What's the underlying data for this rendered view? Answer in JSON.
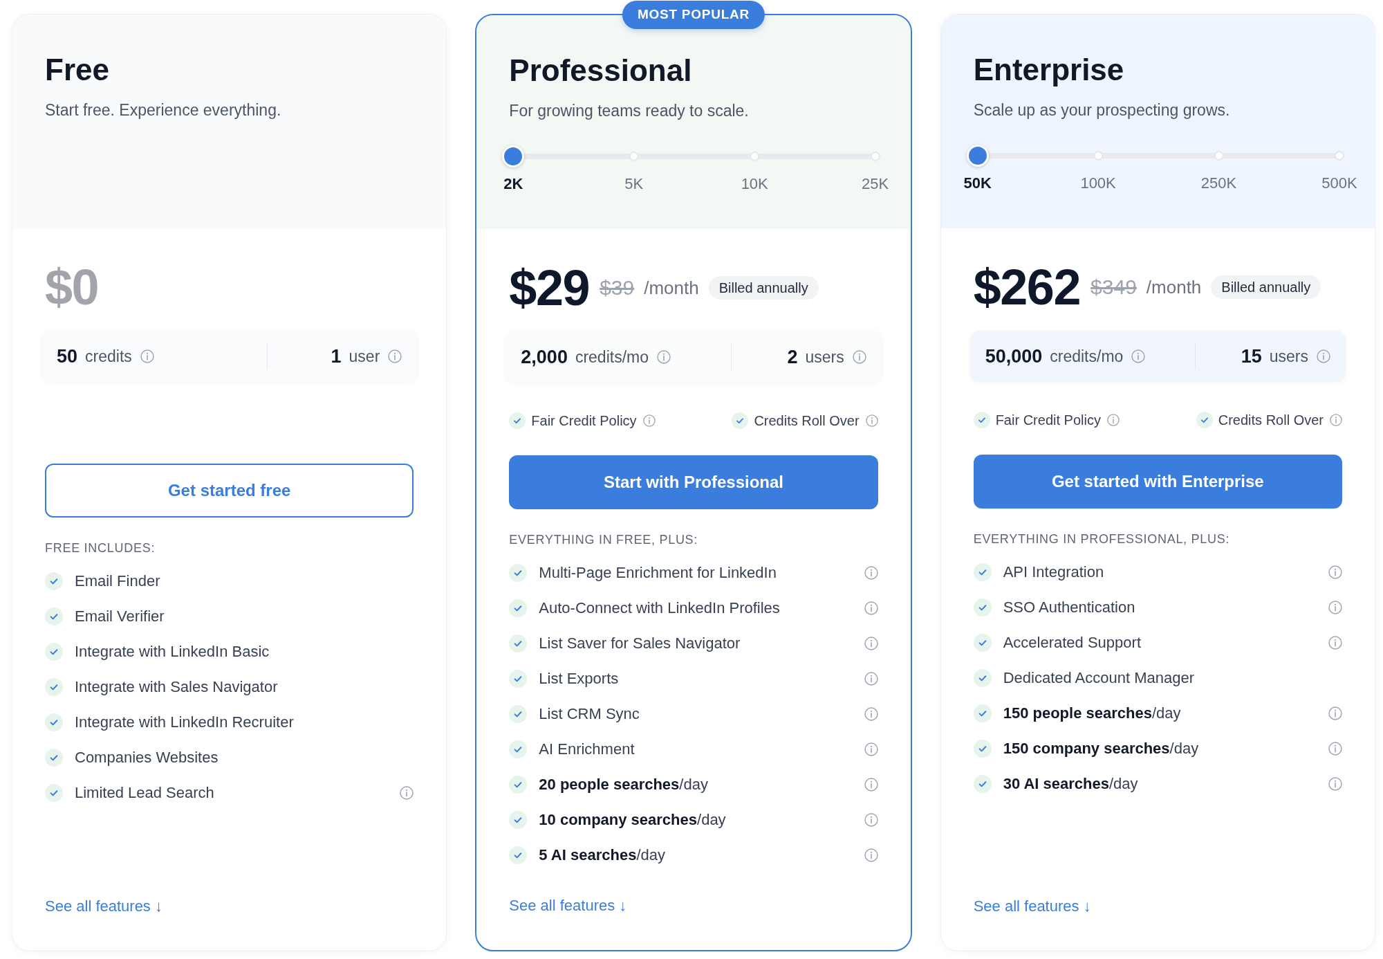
{
  "plans": [
    {
      "name": "Free",
      "kind": "free",
      "highlighted": false,
      "description": "Start free. Experience everything.",
      "price": "$0",
      "stats": [
        {
          "value": "50",
          "label": "credits"
        },
        {
          "value": "1",
          "label": "user"
        }
      ],
      "cta": "Get started free",
      "features_heading": "FREE INCLUDES:",
      "features": [
        {
          "text": "Email Finder",
          "info": false
        },
        {
          "text": "Email Verifier",
          "info": false
        },
        {
          "text": "Integrate with LinkedIn Basic",
          "info": false
        },
        {
          "text": "Integrate with Sales Navigator",
          "info": false
        },
        {
          "text": "Integrate with LinkedIn Recruiter",
          "info": false
        },
        {
          "text": "Companies Websites",
          "info": false
        },
        {
          "text": "Limited Lead Search",
          "info": true
        }
      ],
      "link": "See all features ↓"
    },
    {
      "name": "Professional",
      "kind": "paid",
      "highlighted": true,
      "badge": "MOST POPULAR",
      "description": "For growing teams ready to scale.",
      "slider": {
        "stops": [
          {
            "label": "2K",
            "selected": true
          },
          {
            "label": "5K",
            "selected": false
          },
          {
            "label": "10K",
            "selected": false
          },
          {
            "label": "25K",
            "selected": false
          }
        ]
      },
      "price": "$29",
      "original_price": "$39",
      "period": "/month",
      "billing": "Billed annually",
      "stats": [
        {
          "value": "2,000",
          "label": "credits/mo"
        },
        {
          "value": "2",
          "label": "users"
        }
      ],
      "checks": [
        "Fair Credit Policy",
        "Credits Roll Over"
      ],
      "cta": "Start with Professional",
      "features_heading": "EVERYTHING IN FREE, PLUS:",
      "features": [
        {
          "text": "Multi-Page Enrichment for LinkedIn",
          "info": true
        },
        {
          "text": "Auto-Connect with LinkedIn Profiles",
          "info": true
        },
        {
          "text": "List Saver for Sales Navigator",
          "info": true
        },
        {
          "text": "List Exports",
          "info": true
        },
        {
          "text": "List CRM Sync",
          "info": true
        },
        {
          "text": "AI Enrichment",
          "info": true
        },
        {
          "text": "**20 people searches**/day",
          "info": true
        },
        {
          "text": "**10 company searches**/day",
          "info": true
        },
        {
          "text": "**5 AI searches**/day",
          "info": true
        }
      ],
      "link": "See all features ↓"
    },
    {
      "name": "Enterprise",
      "kind": "paid",
      "highlighted": false,
      "description": "Scale up as your prospecting grows.",
      "slider": {
        "stops": [
          {
            "label": "50K",
            "selected": true
          },
          {
            "label": "100K",
            "selected": false
          },
          {
            "label": "250K",
            "selected": false
          },
          {
            "label": "500K",
            "selected": false
          }
        ]
      },
      "price": "$262",
      "original_price": "$349",
      "period": "/month",
      "billing": "Billed annually",
      "stats": [
        {
          "value": "50,000",
          "label": "credits/mo"
        },
        {
          "value": "15",
          "label": "users"
        }
      ],
      "checks": [
        "Fair Credit Policy",
        "Credits Roll Over"
      ],
      "cta": "Get started with Enterprise",
      "features_heading": "EVERYTHING IN PROFESSIONAL, PLUS:",
      "features": [
        {
          "text": "API Integration",
          "info": true
        },
        {
          "text": "SSO Authentication",
          "info": true
        },
        {
          "text": "Accelerated Support",
          "info": true
        },
        {
          "text": "Dedicated Account Manager",
          "info": false
        },
        {
          "text": "**150 people searches**/day",
          "info": true
        },
        {
          "text": "**150 company searches**/day",
          "info": true
        },
        {
          "text": "**30 AI searches**/day",
          "info": true
        }
      ],
      "link": "See all features ↓"
    }
  ]
}
